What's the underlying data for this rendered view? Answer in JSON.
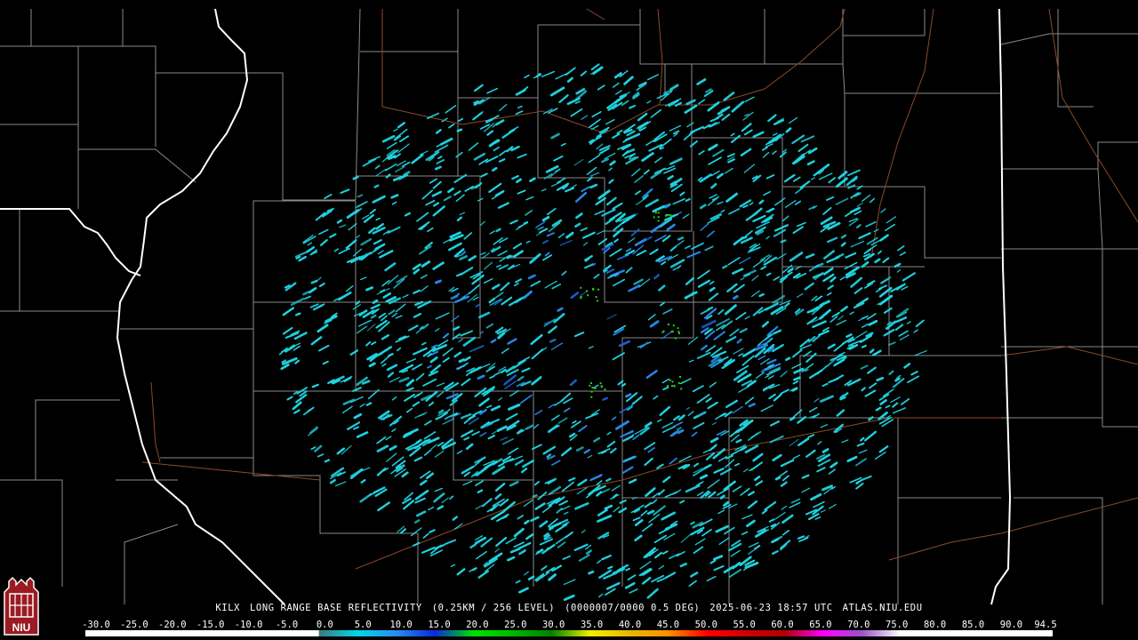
{
  "caption": {
    "station": "KILX",
    "product": "LONG RANGE BASE REFLECTIVITY",
    "resolution": "(0.25KM / 256 LEVEL)",
    "volume": "(0000007/0000 0.5 DEG)",
    "datetime": "2025-06-23 18:57 UTC",
    "source": "ATLAS.NIU.EDU"
  },
  "logo": {
    "text": "NIU",
    "colors": {
      "bg": "#9b1b22",
      "fg": "#ffffff"
    }
  },
  "colorbar": {
    "tick_labels": [
      "-30.0",
      "-25.0",
      "-20.0",
      "-15.0",
      "-10.0",
      "-5.0",
      "0.0",
      "5.0",
      "10.0",
      "15.0",
      "20.0",
      "25.0",
      "30.0",
      "35.0",
      "40.0",
      "45.0",
      "50.0",
      "55.0",
      "60.0",
      "65.0",
      "70.0",
      "75.0",
      "80.0",
      "85.0",
      "90.0",
      "94.5"
    ],
    "tick_values": [
      -30,
      -25,
      -20,
      -15,
      -10,
      -5,
      0,
      5,
      10,
      15,
      20,
      25,
      30,
      35,
      40,
      45,
      50,
      55,
      60,
      65,
      70,
      75,
      80,
      85,
      90,
      94.5
    ],
    "stops": [
      {
        "dbz": -30,
        "color": "#ffffff"
      },
      {
        "dbz": 0,
        "color": "#ffffff"
      },
      {
        "dbz": 0.1,
        "color": "#3e7a7e"
      },
      {
        "dbz": 5,
        "color": "#00d8e8"
      },
      {
        "dbz": 10,
        "color": "#2b8cf0"
      },
      {
        "dbz": 15,
        "color": "#0b2ad8"
      },
      {
        "dbz": 20,
        "color": "#00e000"
      },
      {
        "dbz": 25,
        "color": "#00b800"
      },
      {
        "dbz": 30,
        "color": "#008000"
      },
      {
        "dbz": 35,
        "color": "#f0f000"
      },
      {
        "dbz": 40,
        "color": "#e8b800"
      },
      {
        "dbz": 45,
        "color": "#ff9000"
      },
      {
        "dbz": 50,
        "color": "#ff0000"
      },
      {
        "dbz": 55,
        "color": "#d00000"
      },
      {
        "dbz": 60,
        "color": "#b00000"
      },
      {
        "dbz": 65,
        "color": "#ff00ff"
      },
      {
        "dbz": 70,
        "color": "#9a55c8"
      },
      {
        "dbz": 75,
        "color": "#ffffff"
      },
      {
        "dbz": 94.5,
        "color": "#ffffff"
      }
    ]
  },
  "map": {
    "colors": {
      "background": "#000000",
      "county_lines": "#8a8a8a",
      "state_lines": "#ffffff",
      "highways": "#8b4a2a",
      "echo_primary": "#1fd3df",
      "echo_secondary": "#2a86e8",
      "echo_weak": "#1a5fd0",
      "echo_green": "#2bd020"
    }
  }
}
